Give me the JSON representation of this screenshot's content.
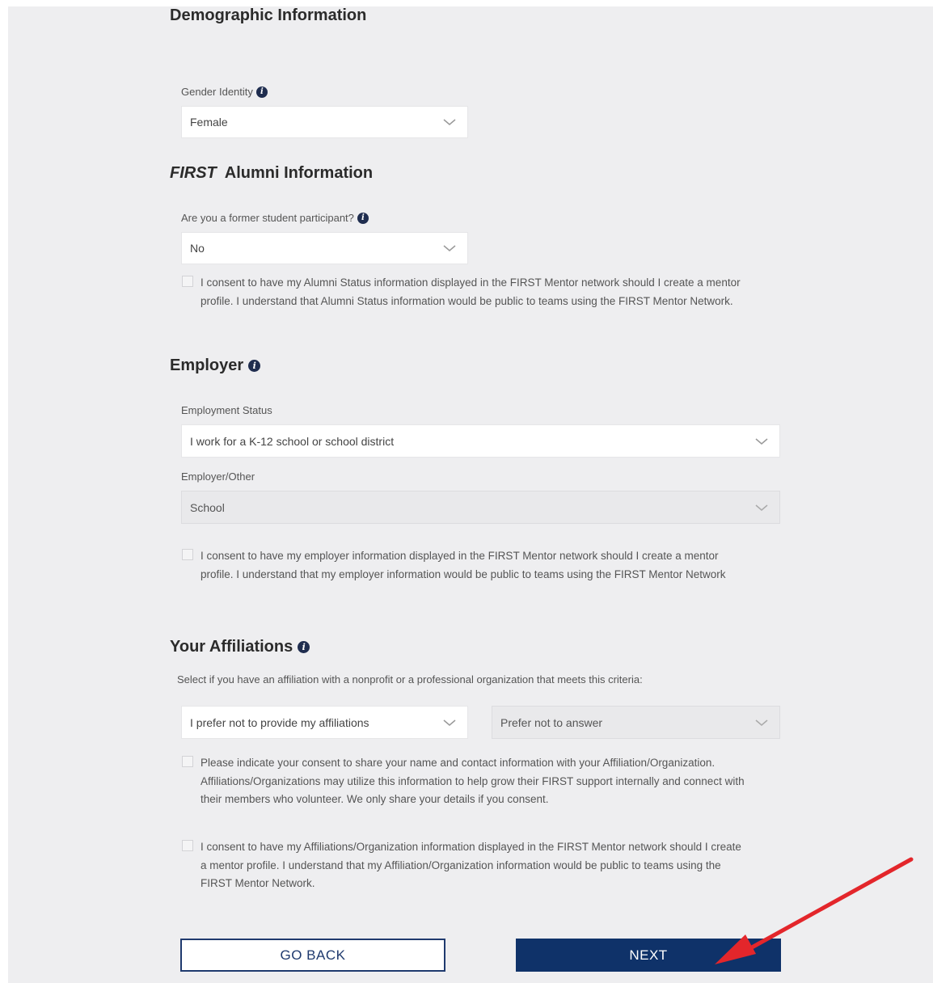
{
  "demographic": {
    "title": "Demographic Information",
    "gender_label": "Gender Identity",
    "gender_value": "Female"
  },
  "alumni": {
    "title_italic": "FIRST",
    "title_rest": "Alumni Information",
    "former_label": "Are you a former student participant?",
    "former_value": "No",
    "consent": "I consent to have my Alumni Status information displayed in the FIRST Mentor network should I create a mentor profile. I understand that Alumni Status information would be public to teams using the FIRST Mentor Network."
  },
  "employer": {
    "title": "Employer",
    "status_label": "Employment Status",
    "status_value": "I work for a K-12 school or school district",
    "other_label": "Employer/Other",
    "other_value": "School",
    "consent": "I consent to have my employer information displayed in the FIRST Mentor network should I create a mentor profile. I understand that my employer information would be public to teams using the FIRST Mentor Network"
  },
  "affiliations": {
    "title": "Your Affiliations",
    "instructions": "Select if you have an affiliation with a nonprofit or a professional organization that meets this criteria:",
    "select_primary": "I prefer not to provide my affiliations",
    "select_secondary": "Prefer not to answer",
    "consent_share": "Please indicate your consent to share your name and contact information with your Affiliation/Organization. Affiliations/Organizations may utilize this information to help grow their FIRST support internally and connect with their members who volunteer. We only share your details if you consent.",
    "consent_display": "I consent to have my Affiliations/Organization information displayed in the FIRST Mentor network should I create a mentor profile. I understand that my Affiliation/Organization information would be public to teams using the FIRST Mentor Network."
  },
  "buttons": {
    "back": "GO BACK",
    "next": "NEXT"
  },
  "colors": {
    "primary": "#0f3269",
    "background": "#eeeef0",
    "arrow": "#e3262b"
  }
}
